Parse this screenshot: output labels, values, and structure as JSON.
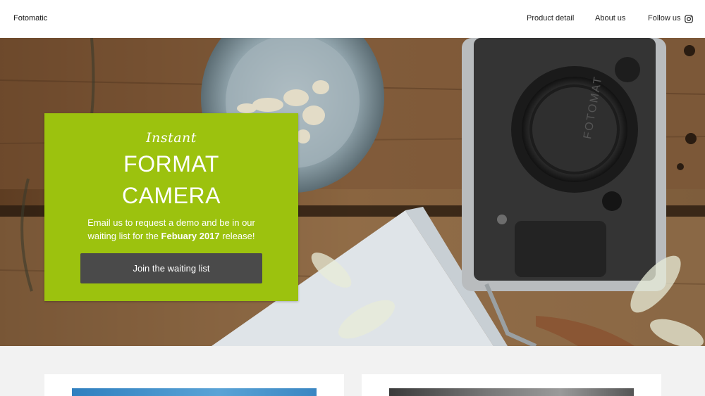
{
  "header": {
    "brand": "Fotomatic",
    "nav": [
      {
        "label": "Product detail"
      },
      {
        "label": "About us"
      },
      {
        "label": "Follow us"
      }
    ],
    "social_icon": "instagram-icon"
  },
  "hero": {
    "script_text": "Instant",
    "title_line1": "FORMAT",
    "title_line2": "CAMERA",
    "desc_part1": "Email us to request a demo and be in our waiting list for the ",
    "desc_bold": "Febuary 2017",
    "desc_part2": " release!",
    "cta_label": "Join the waiting list",
    "camera_brand": "FOTOMAT"
  },
  "colors": {
    "accent": "#9cc20e",
    "button": "#4a4a4a",
    "header_bg": "#ffffff",
    "section_bg": "#f2f2f2"
  }
}
